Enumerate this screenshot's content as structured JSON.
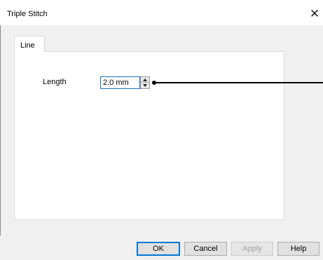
{
  "window": {
    "title": "Triple Stitch",
    "close_glyph": "✕"
  },
  "tabs": [
    {
      "label": "Line",
      "selected": true
    }
  ],
  "form": {
    "length_label": "Length",
    "length_value": "2.0 mm"
  },
  "buttons": {
    "ok": "OK",
    "cancel": "Cancel",
    "apply": "Apply",
    "help": "Help"
  },
  "colors": {
    "focus_accent": "#0078d7",
    "disabled_text": "#a0a0a0"
  }
}
